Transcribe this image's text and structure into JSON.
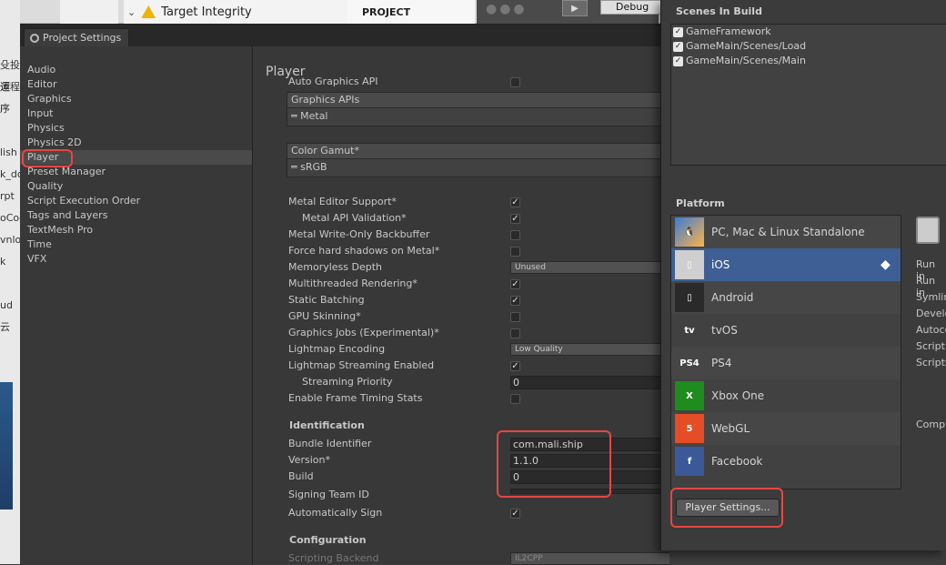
{
  "background": {
    "side_fragments": [
      "殳投运",
      "運程序",
      "i",
      "",
      "lish",
      "k_do",
      "rpt",
      "oCod",
      "vnlo",
      "k",
      "",
      "ud 云"
    ],
    "target_integrity": "Target Integrity",
    "project_tab": "PROJECT",
    "debug_label": "Debug"
  },
  "project_settings": {
    "tab_title": "Project Settings",
    "sidebar": [
      "Audio",
      "Editor",
      "Graphics",
      "Input",
      "Physics",
      "Physics 2D",
      "Player",
      "Preset Manager",
      "Quality",
      "Script Execution Order",
      "Tags and Layers",
      "TextMesh Pro",
      "Time",
      "VFX"
    ],
    "selected": "Player",
    "panel_title": "Player",
    "auto_graphics_api": "Auto Graphics API",
    "graphics_apis_header": "Graphics APIs",
    "graphics_apis_item": "Metal",
    "color_gamut_header": "Color Gamut*",
    "color_gamut_item": "sRGB",
    "settings": [
      {
        "label": "Metal Editor Support*",
        "type": "check",
        "checked": true
      },
      {
        "label": "Metal API Validation*",
        "type": "check",
        "checked": true,
        "indent": true
      },
      {
        "label": "Metal Write-Only Backbuffer",
        "type": "check",
        "checked": false
      },
      {
        "label": "Force hard shadows on Metal*",
        "type": "check",
        "checked": false
      },
      {
        "label": "Memoryless Depth",
        "type": "dropdown",
        "value": "Unused"
      },
      {
        "label": "Multithreaded Rendering*",
        "type": "check",
        "checked": true
      },
      {
        "label": "Static Batching",
        "type": "check",
        "checked": true
      },
      {
        "label": "GPU Skinning*",
        "type": "check",
        "checked": false
      },
      {
        "label": "Graphics Jobs (Experimental)*",
        "type": "check",
        "checked": false
      },
      {
        "label": "Lightmap Encoding",
        "type": "dropdown",
        "value": "Low Quality"
      },
      {
        "label": "Lightmap Streaming Enabled",
        "type": "check",
        "checked": true
      },
      {
        "label": "Streaming Priority",
        "type": "text",
        "value": "0",
        "indent": true
      },
      {
        "label": "Enable Frame Timing Stats",
        "type": "check",
        "checked": false
      }
    ],
    "identification": {
      "heading": "Identification",
      "bundle_identifier_label": "Bundle Identifier",
      "bundle_identifier": "com.mali.ship",
      "version_label": "Version*",
      "version": "1.1.0",
      "build_label": "Build",
      "build": "0",
      "signing_team_label": "Signing Team ID",
      "auto_sign_label": "Automatically Sign"
    },
    "configuration": {
      "heading": "Configuration",
      "scripting_backend_label": "Scripting Backend",
      "scripting_backend": "IL2CPP"
    }
  },
  "build_settings": {
    "scenes_header": "Scenes In Build",
    "scenes": [
      "GameFramework",
      "GameMain/Scenes/Load",
      "GameMain/Scenes/Main"
    ],
    "platform_header": "Platform",
    "platforms": [
      {
        "name": "PC, Mac & Linux Standalone",
        "icon": "pc-icon"
      },
      {
        "name": "iOS",
        "icon": "ios-icon"
      },
      {
        "name": "Android",
        "icon": "android-icon"
      },
      {
        "name": "tvOS",
        "icon": "tvos-icon"
      },
      {
        "name": "PS4",
        "icon": "ps4-icon"
      },
      {
        "name": "Xbox One",
        "icon": "xbox-icon"
      },
      {
        "name": "WebGL",
        "icon": "webgl-icon"
      },
      {
        "name": "Facebook",
        "icon": "facebook-icon"
      }
    ],
    "selected_platform": "iOS",
    "player_settings_button": "Player Settings...",
    "right_options": [
      "Run in",
      "Run in",
      "Symlin",
      "Develo",
      "Autoco",
      "Script",
      "Scripts",
      "Compr"
    ]
  },
  "colors": {
    "selection_blue": "#3e5f96",
    "highlight_red": "#e74545"
  }
}
